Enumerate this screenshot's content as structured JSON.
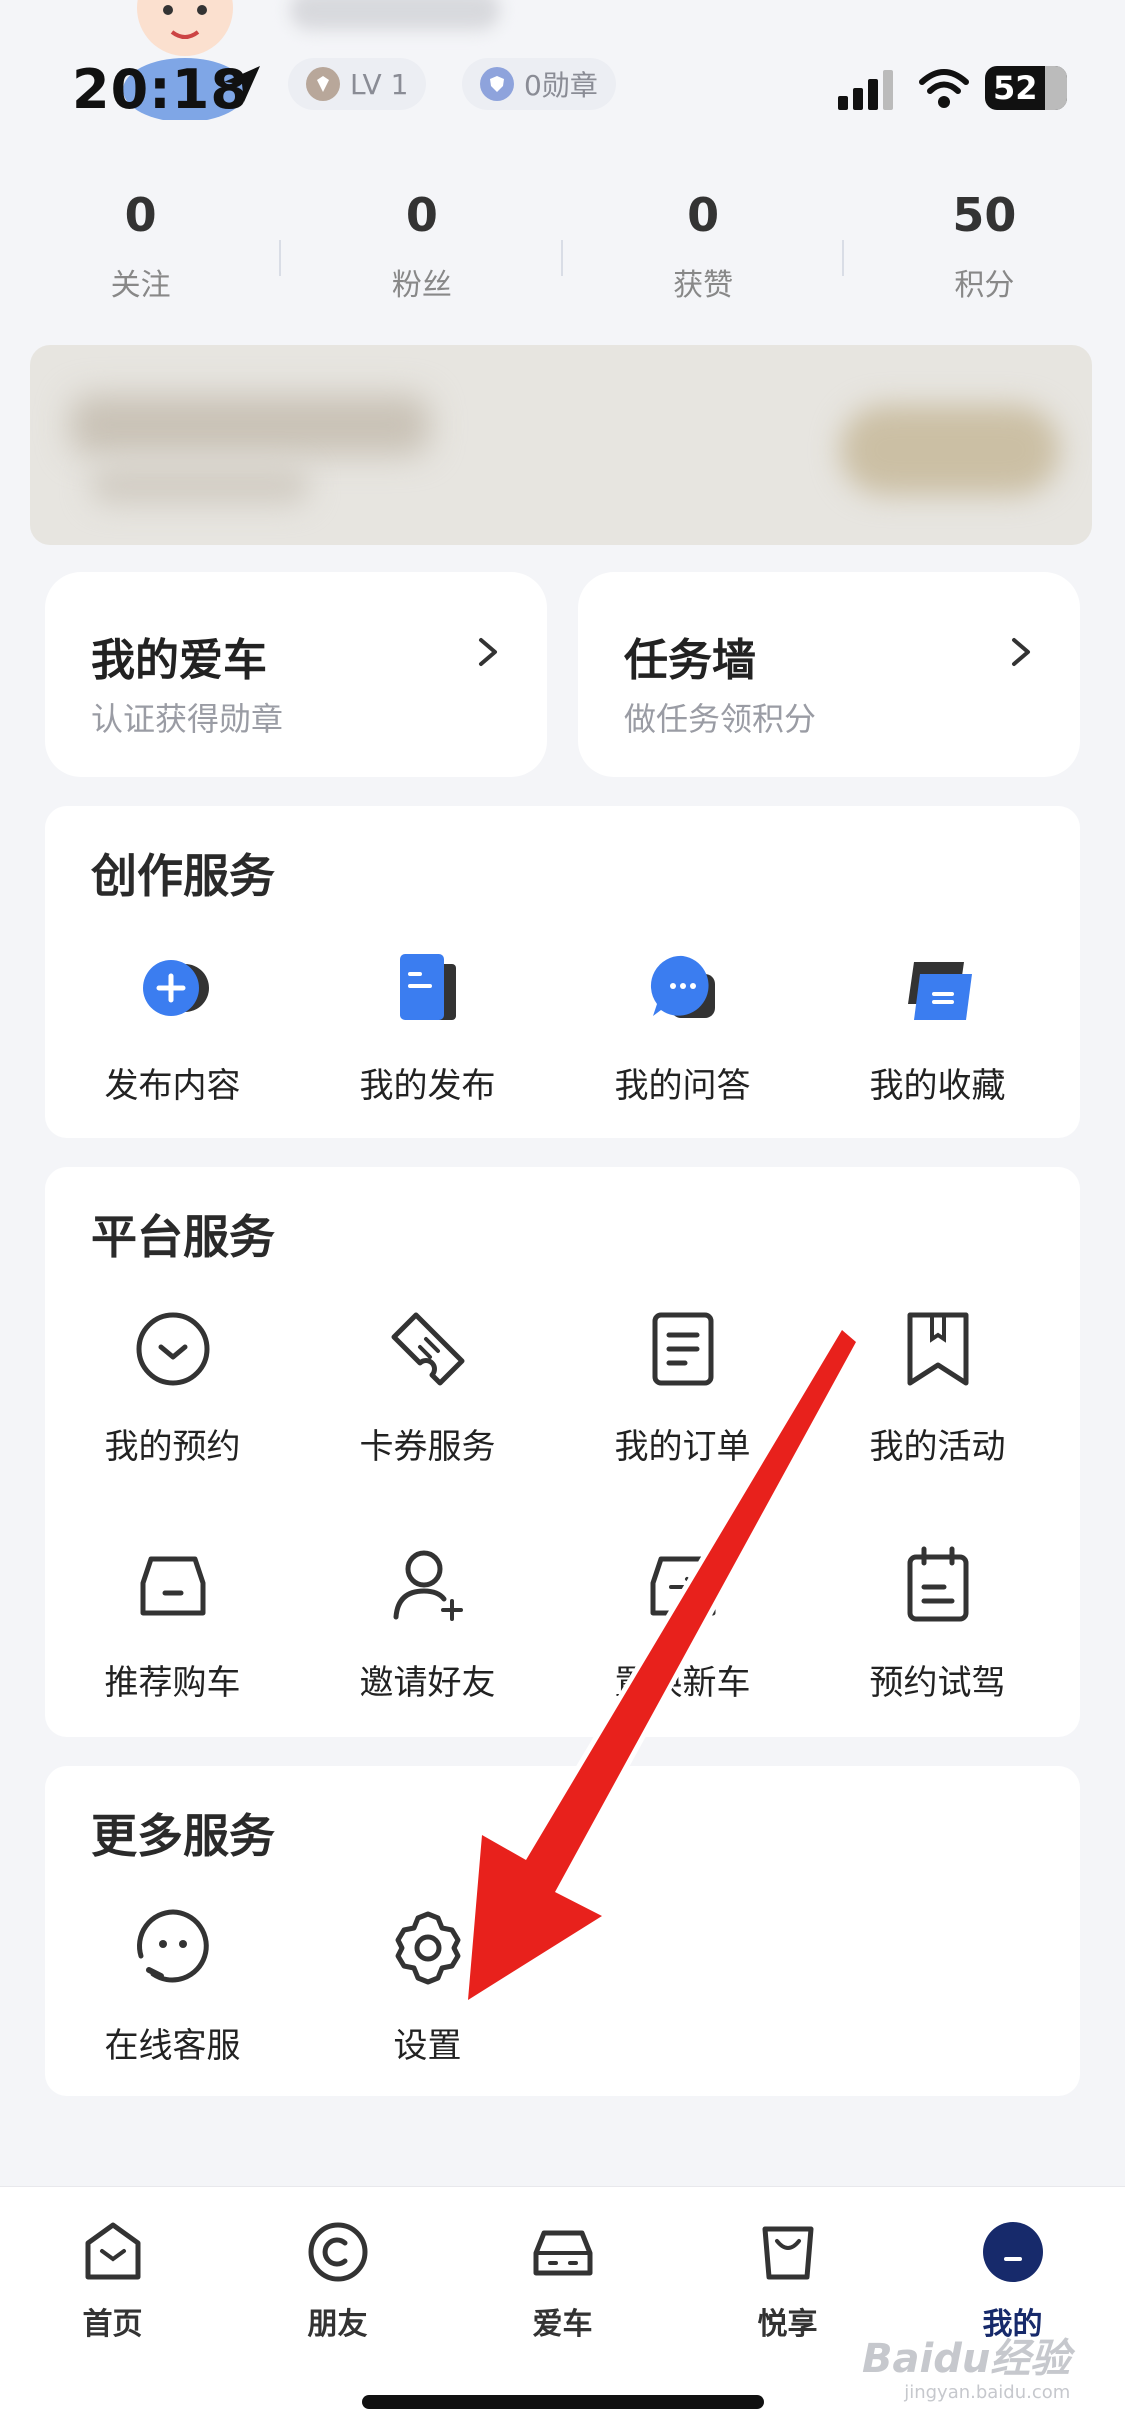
{
  "status_bar": {
    "time": "20:18",
    "battery": "52"
  },
  "profile": {
    "level": "LV 1",
    "badges": "0勋章"
  },
  "stats": [
    {
      "value": "0",
      "label": "关注"
    },
    {
      "value": "0",
      "label": "粉丝"
    },
    {
      "value": "0",
      "label": "获赞"
    },
    {
      "value": "50",
      "label": "积分"
    }
  ],
  "cards": [
    {
      "title": "我的爱车",
      "subtitle": "认证获得勋章"
    },
    {
      "title": "任务墙",
      "subtitle": "做任务领积分"
    }
  ],
  "creation": {
    "title": "创作服务",
    "items": [
      {
        "label": "发布内容",
        "icon": "publish-icon"
      },
      {
        "label": "我的发布",
        "icon": "my-posts-icon"
      },
      {
        "label": "我的问答",
        "icon": "qa-icon"
      },
      {
        "label": "我的收藏",
        "icon": "favorites-icon"
      }
    ]
  },
  "platform": {
    "title": "平台服务",
    "items": [
      {
        "label": "我的预约",
        "icon": "appointment-icon"
      },
      {
        "label": "卡券服务",
        "icon": "coupon-icon"
      },
      {
        "label": "我的订单",
        "icon": "order-icon"
      },
      {
        "label": "我的活动",
        "icon": "bookmark-icon"
      },
      {
        "label": "推荐购车",
        "icon": "car-icon"
      },
      {
        "label": "邀请好友",
        "icon": "invite-icon"
      },
      {
        "label": "置换新车",
        "icon": "trade-in-icon"
      },
      {
        "label": "预约试驾",
        "icon": "calendar-icon"
      }
    ]
  },
  "more": {
    "title": "更多服务",
    "items": [
      {
        "label": "在线客服",
        "icon": "support-icon"
      },
      {
        "label": "设置",
        "icon": "gear-icon"
      }
    ]
  },
  "nav": [
    {
      "label": "首页",
      "icon": "home-icon"
    },
    {
      "label": "朋友",
      "icon": "friends-icon"
    },
    {
      "label": "爱车",
      "icon": "car-icon"
    },
    {
      "label": "悦享",
      "icon": "shop-bag-icon"
    },
    {
      "label": "我的",
      "icon": "profile-icon"
    }
  ],
  "watermark": {
    "brand": "Baidu经验",
    "url": "jingyan.baidu.com"
  },
  "colors": {
    "accent_blue": "#3b7df0",
    "nav_active": "#172a6b",
    "arrow_red": "#e8211c"
  }
}
